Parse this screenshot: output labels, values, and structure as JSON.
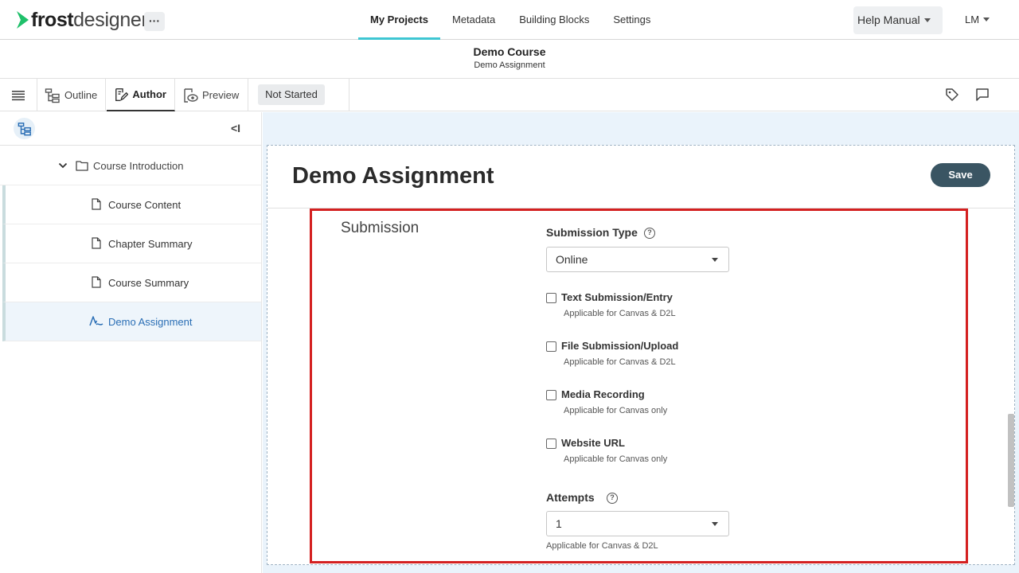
{
  "app": {
    "logo_part1": "frost",
    "logo_part2": "designer",
    "more_label": "···"
  },
  "nav": {
    "items": [
      "My Projects",
      "Metadata",
      "Building Blocks",
      "Settings"
    ],
    "active": "My Projects"
  },
  "header_right": {
    "help_label": "Help Manual",
    "user_initials": "LM"
  },
  "course": {
    "title": "Demo Course",
    "subtitle": "Demo Assignment"
  },
  "toolbar": {
    "tabs": [
      "Outline",
      "Author",
      "Preview"
    ],
    "active_tab": "Author",
    "status": "Not Started"
  },
  "sidebar": {
    "collapse_label": "<I",
    "folder": "Course Introduction",
    "items": [
      {
        "label": "Course Content",
        "icon": "document-icon",
        "selected": false
      },
      {
        "label": "Chapter Summary",
        "icon": "document-icon",
        "selected": false
      },
      {
        "label": "Course Summary",
        "icon": "document-icon",
        "selected": false
      },
      {
        "label": "Demo Assignment",
        "icon": "assignment-icon",
        "selected": true
      }
    ]
  },
  "main": {
    "title": "Demo Assignment",
    "save_label": "Save",
    "section_label": "Submission",
    "submission_type": {
      "label": "Submission Type",
      "value": "Online"
    },
    "options": [
      {
        "label": "Text Submission/Entry",
        "note": "Applicable for Canvas & D2L",
        "checked": false
      },
      {
        "label": "File Submission/Upload",
        "note": "Applicable for Canvas & D2L",
        "checked": false
      },
      {
        "label": "Media Recording",
        "note": "Applicable for Canvas only",
        "checked": false
      },
      {
        "label": "Website URL",
        "note": "Applicable for Canvas only",
        "checked": false
      }
    ],
    "attempts": {
      "label": "Attempts",
      "value": "1",
      "note": "Applicable for Canvas & D2L"
    }
  },
  "colors": {
    "accent": "#3ec6d3",
    "logo_green": "#1fc06a",
    "save_button": "#3a5563",
    "highlight": "#d42020",
    "selected_text": "#2a6eb5"
  }
}
